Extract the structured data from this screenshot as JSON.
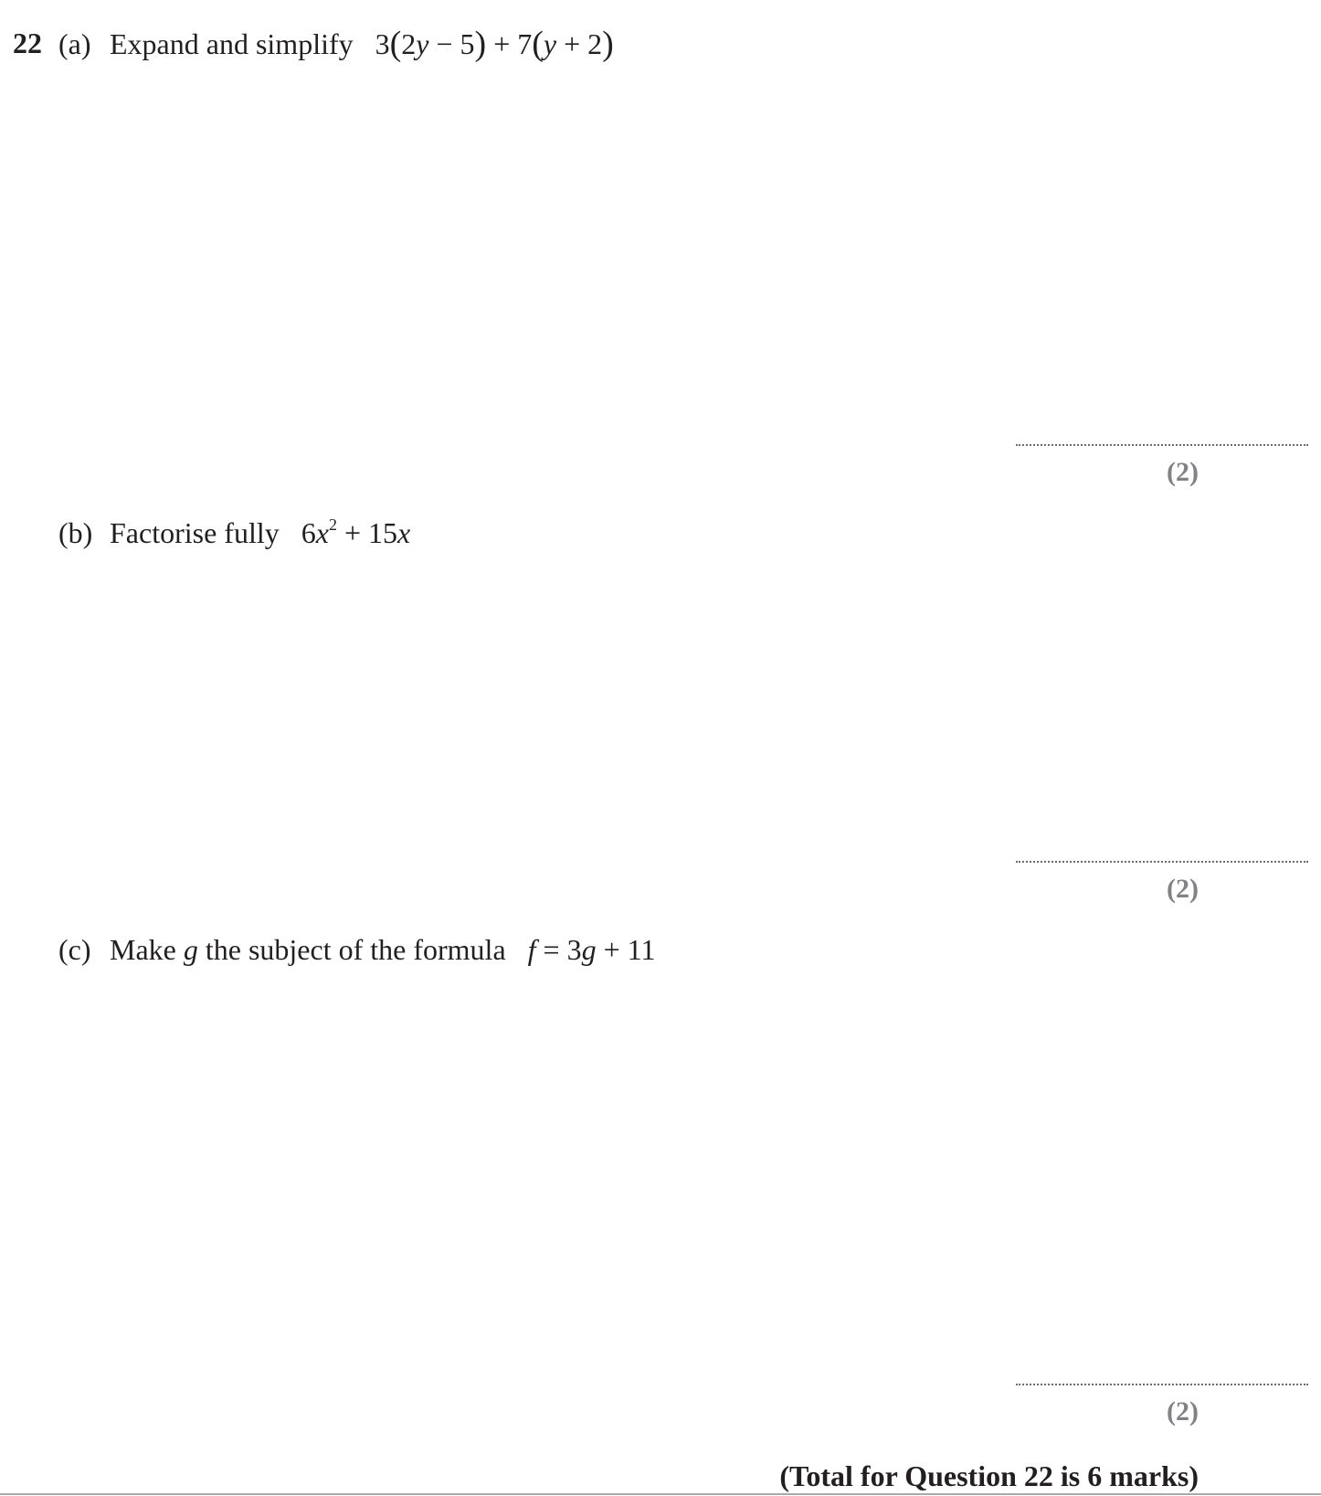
{
  "question": {
    "number": "22",
    "total_text": "(Total for Question 22 is 6 marks)"
  },
  "parts": [
    {
      "label": "(a)",
      "instruction": "Expand and simplify",
      "expression": {
        "a": "3",
        "b": "2",
        "var": "y",
        "op1": "−",
        "c": "5",
        "op2": "+",
        "d": "7",
        "op3": "+",
        "e": "2"
      },
      "marks": "(2)"
    },
    {
      "label": "(b)",
      "instruction": "Factorise fully",
      "expression": {
        "coef1": "6",
        "var": "x",
        "power": "2",
        "op": "+",
        "coef2": "15"
      },
      "marks": "(2)"
    },
    {
      "label": "(c)",
      "instruction_pre": "Make",
      "subject_var": "g",
      "instruction_post": "the subject of the formula",
      "expression": {
        "lhs": "f",
        "eq": "=",
        "coef": "3",
        "var": "g",
        "op": "+",
        "const": "11"
      },
      "marks": "(2)"
    }
  ]
}
